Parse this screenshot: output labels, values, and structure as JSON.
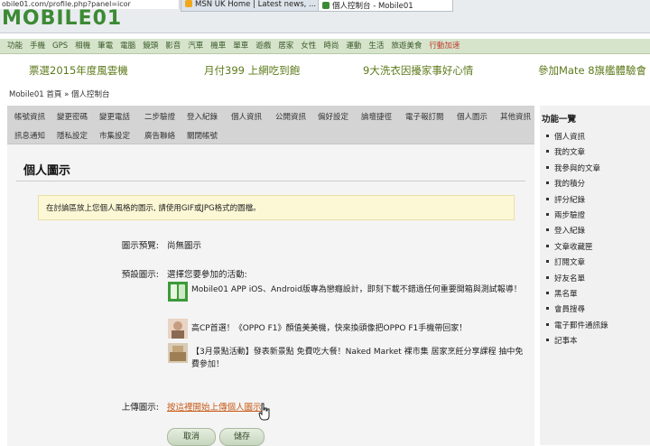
{
  "browser": {
    "url": "obile01.com/profile.php?panel=icor",
    "tabs": [
      {
        "label": "MSN UK Home | Latest news, ..."
      },
      {
        "label": "個人控制台 - Mobile01"
      }
    ]
  },
  "logo": {
    "text": "MOBILE01"
  },
  "nav": {
    "items": [
      "功能",
      "手機",
      "GPS",
      "相機",
      "筆電",
      "電腦",
      "鏡頭",
      "影音",
      "汽車",
      "機車",
      "單車",
      "遊戲",
      "居家",
      "女性",
      "時尚",
      "運動",
      "生活",
      "旅遊美食",
      "行動加速"
    ]
  },
  "ads": [
    "票選2015年度風雲機",
    "月付399 上網吃到飽",
    "9大洗衣因擾家事好心情",
    "參加Mate 8旗艦體驗會"
  ],
  "breadcrumb": "Mobile01 首頁 » 個人控制台",
  "control_tabs": {
    "row1": [
      "帳號資訊",
      "變更密碼",
      "變更電話",
      "二步驗證",
      "登入紀錄",
      "個人資訊",
      "公開資訊",
      "偏好設定",
      "論壇捷徑",
      "電子報訂閱",
      "個人圖示",
      "其他資訊"
    ],
    "row2": [
      "訊息通知",
      "隱私設定",
      "市集設定",
      "廣告聯絡",
      "關閉帳號"
    ]
  },
  "page_title": "個人圖示",
  "notice": "在討論區放上您個人風格的圖示, 請使用GIF或JPG格式的圖檔。",
  "form": {
    "preview_label": "圖示預覽:",
    "preview_value": "尚無圖示",
    "default_label": "預設圖示:",
    "default_intro": "選擇您要參加的活動:",
    "activities": [
      {
        "text": "Mobile01 APP iOS、Android版專為戀癮設計，即刻下載不錯過任何重要開箱與測試報導！"
      },
      {
        "text": "高CP首選！《OPPO F1》顏值美美機，快來換頭像把OPPO F1手機帶回家！"
      },
      {
        "text": "【3月景點活動】發表新景點 免費吃大餐！Naked Market 裸市集 居家烹飪分享課程 抽中免費參加！"
      }
    ],
    "upload_label": "上傳圖示:",
    "upload_link": "按這裡開始上傳個人圖示",
    "cancel_label": "取消",
    "save_label": "儲存"
  },
  "sidebar": {
    "title": "功能一覽",
    "items": [
      "個人資訊",
      "我的文章",
      "我參與的文章",
      "我的積分",
      "評分紀錄",
      "兩步驗證",
      "登入紀錄",
      "文章收藏匣",
      "訂閱文章",
      "好友名單",
      "黑名單",
      "會員搜尋",
      "電子郵件通訊錄",
      "記事本"
    ]
  },
  "colors": {
    "accent": "#3c8a34",
    "nav_bg": "#d6e4cc",
    "notice_bg": "#fcf8d5",
    "link": "#c85a18"
  }
}
